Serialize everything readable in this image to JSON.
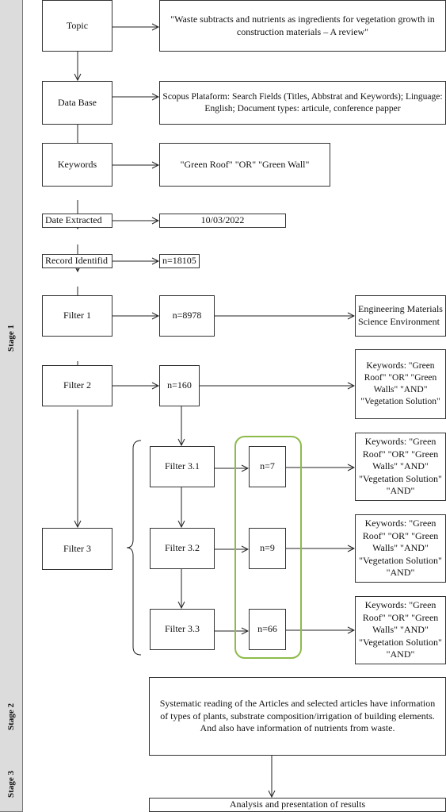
{
  "stages": [
    "Stage 1",
    "Stage 2",
    "Stage 3"
  ],
  "steps": {
    "topic": {
      "label": "Topic",
      "value": "\"Waste subtracts and nutrients as ingredients for vegetation growth in construction materials – A review\""
    },
    "database": {
      "label": "Data Base",
      "value": "Scopus Plataform: Search Fields (Titles, Abbstrat and Keywords); Linguage: English; Document types: articule, conference papper"
    },
    "keywords": {
      "label": "Keywords",
      "value": "\"Green Roof\" \"OR\" \"Green Wall\""
    },
    "date": {
      "label": "Date Extracted",
      "value": "10/03/2022"
    },
    "record": {
      "label": "Record Identifid",
      "value": "n=18105"
    },
    "filter1": {
      "label": "Filter 1",
      "count": "n=8978",
      "criteria": "Engineering Materials Science Environment"
    },
    "filter2": {
      "label": "Filter 2",
      "count": "n=160",
      "criteria": "Keywords: \"Green Roof\" \"OR\" \"Green Walls\" \"AND\" \"Vegetation Solution\""
    },
    "filter3": {
      "label": "Filter 3"
    },
    "filter3_1": {
      "label": "Filter 3.1",
      "count": "n=7",
      "criteria": "Keywords: \"Green Roof\" \"OR\" \"Green Walls\" \"AND\" \"Vegetation Solution\" \"AND\""
    },
    "filter3_2": {
      "label": "Filter 3.2",
      "count": "n=9",
      "criteria": "Keywords: \"Green Roof\" \"OR\" \"Green Walls\" \"AND\" \"Vegetation Solution\" \"AND\""
    },
    "filter3_3": {
      "label": "Filter 3.3",
      "count": "n=66",
      "criteria": "Keywords: \"Green Roof\" \"OR\" \"Green Walls\" \"AND\" \"Vegetation Solution\" \"AND\""
    },
    "stage2": "Systematic reading of the Articles and selected articles have information of types of plants, substrate composition/irrigation of building elements. And also have information of nutrients from waste.",
    "stage3": "Analysis and presentation of results"
  },
  "colors": {
    "highlight": "#8dbb4a",
    "stage_bg": "#dcdcdc"
  }
}
